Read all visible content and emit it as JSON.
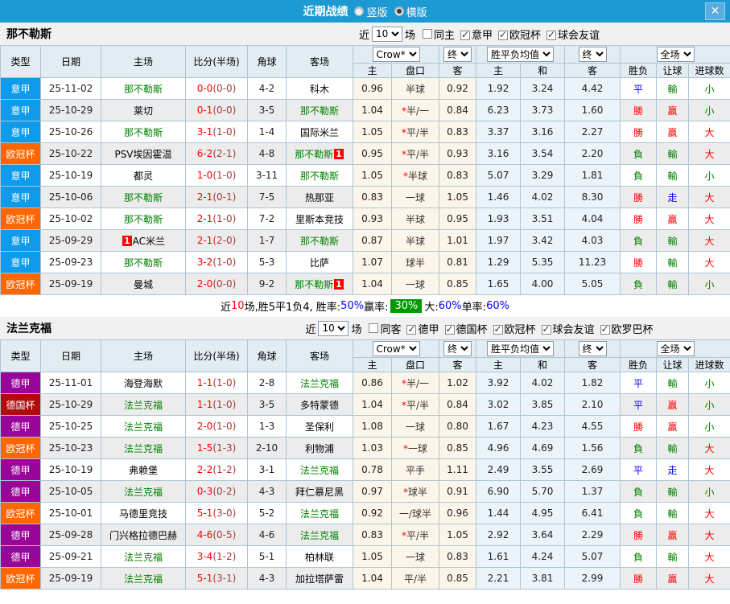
{
  "window": {
    "title": "近期战绩",
    "layout_options": [
      {
        "label": "竖版",
        "selected": false
      },
      {
        "label": "横版",
        "selected": true
      }
    ],
    "close_label": "✕"
  },
  "colors": {
    "header_bar": "#1e9ad3",
    "team_highlight": "#008000",
    "score_main": "#ff0000",
    "score_half": "#a33c3c",
    "league_types": {
      "意甲": "#0f9bea",
      "欧冠杯": "#ff6600",
      "德甲": "#990599",
      "德国杯": "#b20b0b"
    },
    "result_words": {
      "勝": "#ff0000",
      "贏": "#ff0000",
      "大": "#ff0000",
      "平": "#0000ff",
      "走": "#0000ff",
      "負": "#008000",
      "輸": "#008000",
      "小": "#008000"
    },
    "summary_badge_bg": "#009900"
  },
  "table": {
    "columns": {
      "type": "类型",
      "date": "日期",
      "home": "主场",
      "score": "比分(半场)",
      "corners": "角球",
      "away": "客场",
      "odds_home": "主",
      "odds_handicap": "盘口",
      "odds_away": "客",
      "avg_home": "主",
      "avg_draw": "和",
      "avg_away": "客",
      "res_wl": "胜负",
      "res_handicap": "让球",
      "res_goals": "进球数"
    },
    "dropdowns": {
      "company": "Crow*",
      "final1": "终",
      "avg": "胜平负均值",
      "final2": "终",
      "scope": "全场"
    }
  },
  "sections": [
    {
      "team": "那不勒斯",
      "filter": {
        "recent_label": "近",
        "count": "10",
        "unit_label": "场",
        "venue_checkbox": {
          "label": "同主",
          "checked": false
        },
        "leagues": [
          {
            "label": "意甲",
            "checked": true
          },
          {
            "label": "欧冠杯",
            "checked": true
          },
          {
            "label": "球会友谊",
            "checked": true
          }
        ]
      },
      "rows": [
        {
          "type": "意甲",
          "date": "25-11-02",
          "home": {
            "name": "那不勒斯",
            "highlight": true
          },
          "score": "0-0",
          "half": "0-0",
          "corners": "4-2",
          "away": {
            "name": "科木",
            "highlight": false
          },
          "odds": [
            "0.96",
            "半球",
            "0.92"
          ],
          "avg": [
            "1.92",
            "3.24",
            "4.42"
          ],
          "results": [
            "平",
            "輸",
            "小"
          ]
        },
        {
          "type": "意甲",
          "date": "25-10-29",
          "home": {
            "name": "莱切",
            "highlight": false
          },
          "score": "0-1",
          "half": "0-0",
          "corners": "3-5",
          "away": {
            "name": "那不勒斯",
            "highlight": true
          },
          "odds": [
            "1.04",
            "*半/一",
            "0.84"
          ],
          "avg": [
            "6.23",
            "3.73",
            "1.60"
          ],
          "results": [
            "勝",
            "贏",
            "小"
          ]
        },
        {
          "type": "意甲",
          "date": "25-10-26",
          "home": {
            "name": "那不勒斯",
            "highlight": true
          },
          "score": "3-1",
          "half": "1-0",
          "corners": "1-4",
          "away": {
            "name": "国际米兰",
            "highlight": false
          },
          "odds": [
            "1.05",
            "*平/半",
            "0.83"
          ],
          "avg": [
            "3.37",
            "3.16",
            "2.27"
          ],
          "results": [
            "勝",
            "贏",
            "大"
          ]
        },
        {
          "type": "欧冠杯",
          "date": "25-10-22",
          "home": {
            "name": "PSV埃因霍温",
            "highlight": false
          },
          "score": "6-2",
          "half": "2-1",
          "corners": "4-8",
          "away": {
            "name": "那不勒斯",
            "highlight": true,
            "badge": "1",
            "badge_pos": "after"
          },
          "odds": [
            "0.95",
            "*平/半",
            "0.93"
          ],
          "avg": [
            "3.16",
            "3.54",
            "2.20"
          ],
          "results": [
            "負",
            "輸",
            "大"
          ]
        },
        {
          "type": "意甲",
          "date": "25-10-19",
          "home": {
            "name": "都灵",
            "highlight": false
          },
          "score": "1-0",
          "half": "1-0",
          "corners": "3-11",
          "away": {
            "name": "那不勒斯",
            "highlight": true
          },
          "odds": [
            "1.05",
            "*半球",
            "0.83"
          ],
          "avg": [
            "5.07",
            "3.29",
            "1.81"
          ],
          "results": [
            "負",
            "輸",
            "小"
          ]
        },
        {
          "type": "意甲",
          "date": "25-10-06",
          "home": {
            "name": "那不勒斯",
            "highlight": true
          },
          "score": "2-1",
          "half": "0-1",
          "corners": "7-5",
          "away": {
            "name": "热那亚",
            "highlight": false
          },
          "odds": [
            "0.83",
            "一球",
            "1.05"
          ],
          "avg": [
            "1.46",
            "4.02",
            "8.30"
          ],
          "results": [
            "勝",
            "走",
            "大"
          ]
        },
        {
          "type": "欧冠杯",
          "date": "25-10-02",
          "home": {
            "name": "那不勒斯",
            "highlight": true
          },
          "score": "2-1",
          "half": "1-0",
          "corners": "7-2",
          "away": {
            "name": "里斯本竞技",
            "highlight": false
          },
          "odds": [
            "0.93",
            "半球",
            "0.95"
          ],
          "avg": [
            "1.93",
            "3.51",
            "4.04"
          ],
          "results": [
            "勝",
            "贏",
            "大"
          ]
        },
        {
          "type": "意甲",
          "date": "25-09-29",
          "home": {
            "name": "AC米兰",
            "highlight": false,
            "badge": "1",
            "badge_pos": "before"
          },
          "score": "2-1",
          "half": "2-0",
          "corners": "1-7",
          "away": {
            "name": "那不勒斯",
            "highlight": true
          },
          "odds": [
            "0.87",
            "半球",
            "1.01"
          ],
          "avg": [
            "1.97",
            "3.42",
            "4.03"
          ],
          "results": [
            "負",
            "輸",
            "大"
          ]
        },
        {
          "type": "意甲",
          "date": "25-09-23",
          "home": {
            "name": "那不勒斯",
            "highlight": true
          },
          "score": "3-2",
          "half": "1-0",
          "corners": "5-3",
          "away": {
            "name": "比萨",
            "highlight": false
          },
          "odds": [
            "1.07",
            "球半",
            "0.81"
          ],
          "avg": [
            "1.29",
            "5.35",
            "11.23"
          ],
          "results": [
            "勝",
            "輸",
            "大"
          ]
        },
        {
          "type": "欧冠杯",
          "date": "25-09-19",
          "home": {
            "name": "曼城",
            "highlight": false
          },
          "score": "2-0",
          "half": "0-0",
          "corners": "9-2",
          "away": {
            "name": "那不勒斯",
            "highlight": true,
            "badge": "1",
            "badge_pos": "after"
          },
          "odds": [
            "1.04",
            "一球",
            "0.85"
          ],
          "avg": [
            "1.65",
            "4.00",
            "5.05"
          ],
          "results": [
            "負",
            "輸",
            "小"
          ]
        }
      ],
      "summary_parts": [
        {
          "text": "近",
          "color": "black"
        },
        {
          "text": "10",
          "color": "red"
        },
        {
          "text": "场,胜5平1负4, 胜率:",
          "color": "black"
        },
        {
          "text": "50%",
          "color": "blue"
        },
        {
          "text": " 赢率:",
          "color": "black"
        },
        {
          "text": "30%",
          "color": "badge"
        },
        {
          "text": " 大:",
          "color": "black"
        },
        {
          "text": "60%",
          "color": "blue"
        },
        {
          "text": " 单率:",
          "color": "black"
        },
        {
          "text": "60%",
          "color": "blue"
        }
      ]
    },
    {
      "team": "法兰克福",
      "filter": {
        "recent_label": "近",
        "count": "10",
        "unit_label": "场",
        "venue_checkbox": {
          "label": "同客",
          "checked": false
        },
        "leagues": [
          {
            "label": "德甲",
            "checked": true
          },
          {
            "label": "德国杯",
            "checked": true
          },
          {
            "label": "欧冠杯",
            "checked": true
          },
          {
            "label": "球会友谊",
            "checked": true
          },
          {
            "label": "欧罗巴杯",
            "checked": true
          }
        ]
      },
      "rows": [
        {
          "type": "德甲",
          "date": "25-11-01",
          "home": {
            "name": "海登海默",
            "highlight": false
          },
          "score": "1-1",
          "half": "1-0",
          "corners": "2-8",
          "away": {
            "name": "法兰克福",
            "highlight": true
          },
          "odds": [
            "0.86",
            "*半/一",
            "1.02"
          ],
          "avg": [
            "3.92",
            "4.02",
            "1.82"
          ],
          "results": [
            "平",
            "輸",
            "小"
          ]
        },
        {
          "type": "德国杯",
          "date": "25-10-29",
          "home": {
            "name": "法兰克福",
            "highlight": true
          },
          "score": "1-1",
          "half": "1-0",
          "corners": "3-5",
          "away": {
            "name": "多特蒙德",
            "highlight": false
          },
          "odds": [
            "1.04",
            "*平/半",
            "0.84"
          ],
          "avg": [
            "3.02",
            "3.85",
            "2.10"
          ],
          "results": [
            "平",
            "贏",
            "小"
          ]
        },
        {
          "type": "德甲",
          "date": "25-10-25",
          "home": {
            "name": "法兰克福",
            "highlight": true
          },
          "score": "2-0",
          "half": "1-0",
          "corners": "1-3",
          "away": {
            "name": "圣保利",
            "highlight": false
          },
          "odds": [
            "1.08",
            "一球",
            "0.80"
          ],
          "avg": [
            "1.67",
            "4.23",
            "4.55"
          ],
          "results": [
            "勝",
            "贏",
            "小"
          ]
        },
        {
          "type": "欧冠杯",
          "date": "25-10-23",
          "home": {
            "name": "法兰克福",
            "highlight": true
          },
          "score": "1-5",
          "half": "1-3",
          "corners": "2-10",
          "away": {
            "name": "利物浦",
            "highlight": false
          },
          "odds": [
            "1.03",
            "*一球",
            "0.85"
          ],
          "avg": [
            "4.96",
            "4.69",
            "1.56"
          ],
          "results": [
            "負",
            "輸",
            "大"
          ]
        },
        {
          "type": "德甲",
          "date": "25-10-19",
          "home": {
            "name": "弗赖堡",
            "highlight": false
          },
          "score": "2-2",
          "half": "1-2",
          "corners": "3-1",
          "away": {
            "name": "法兰克福",
            "highlight": true
          },
          "odds": [
            "0.78",
            "平手",
            "1.11"
          ],
          "avg": [
            "2.49",
            "3.55",
            "2.69"
          ],
          "results": [
            "平",
            "走",
            "大"
          ]
        },
        {
          "type": "德甲",
          "date": "25-10-05",
          "home": {
            "name": "法兰克福",
            "highlight": true
          },
          "score": "0-3",
          "half": "0-2",
          "corners": "4-3",
          "away": {
            "name": "拜仁慕尼黑",
            "highlight": false
          },
          "odds": [
            "0.97",
            "*球半",
            "0.91"
          ],
          "avg": [
            "6.90",
            "5.70",
            "1.37"
          ],
          "results": [
            "負",
            "輸",
            "小"
          ]
        },
        {
          "type": "欧冠杯",
          "date": "25-10-01",
          "home": {
            "name": "马德里竞技",
            "highlight": false
          },
          "score": "5-1",
          "half": "3-0",
          "corners": "5-2",
          "away": {
            "name": "法兰克福",
            "highlight": true
          },
          "odds": [
            "0.92",
            "一/球半",
            "0.96"
          ],
          "avg": [
            "1.44",
            "4.95",
            "6.41"
          ],
          "results": [
            "負",
            "輸",
            "大"
          ]
        },
        {
          "type": "德甲",
          "date": "25-09-28",
          "home": {
            "name": "门兴格拉德巴赫",
            "highlight": false
          },
          "score": "4-6",
          "half": "0-5",
          "corners": "4-6",
          "away": {
            "name": "法兰克福",
            "highlight": true
          },
          "odds": [
            "0.83",
            "*平/半",
            "1.05"
          ],
          "avg": [
            "2.92",
            "3.64",
            "2.29"
          ],
          "results": [
            "勝",
            "贏",
            "大"
          ]
        },
        {
          "type": "德甲",
          "date": "25-09-21",
          "home": {
            "name": "法兰克福",
            "highlight": true
          },
          "score": "3-4",
          "half": "1-2",
          "corners": "5-1",
          "away": {
            "name": "柏林联",
            "highlight": false
          },
          "odds": [
            "1.05",
            "一球",
            "0.83"
          ],
          "avg": [
            "1.61",
            "4.24",
            "5.07"
          ],
          "results": [
            "負",
            "輸",
            "大"
          ]
        },
        {
          "type": "欧冠杯",
          "date": "25-09-19",
          "home": {
            "name": "法兰克福",
            "highlight": true
          },
          "score": "5-1",
          "half": "3-1",
          "corners": "4-3",
          "away": {
            "name": "加拉塔萨雷",
            "highlight": false
          },
          "odds": [
            "1.04",
            "平/半",
            "0.85"
          ],
          "avg": [
            "2.21",
            "3.81",
            "2.99"
          ],
          "results": [
            "勝",
            "贏",
            "大"
          ]
        }
      ]
    }
  ]
}
